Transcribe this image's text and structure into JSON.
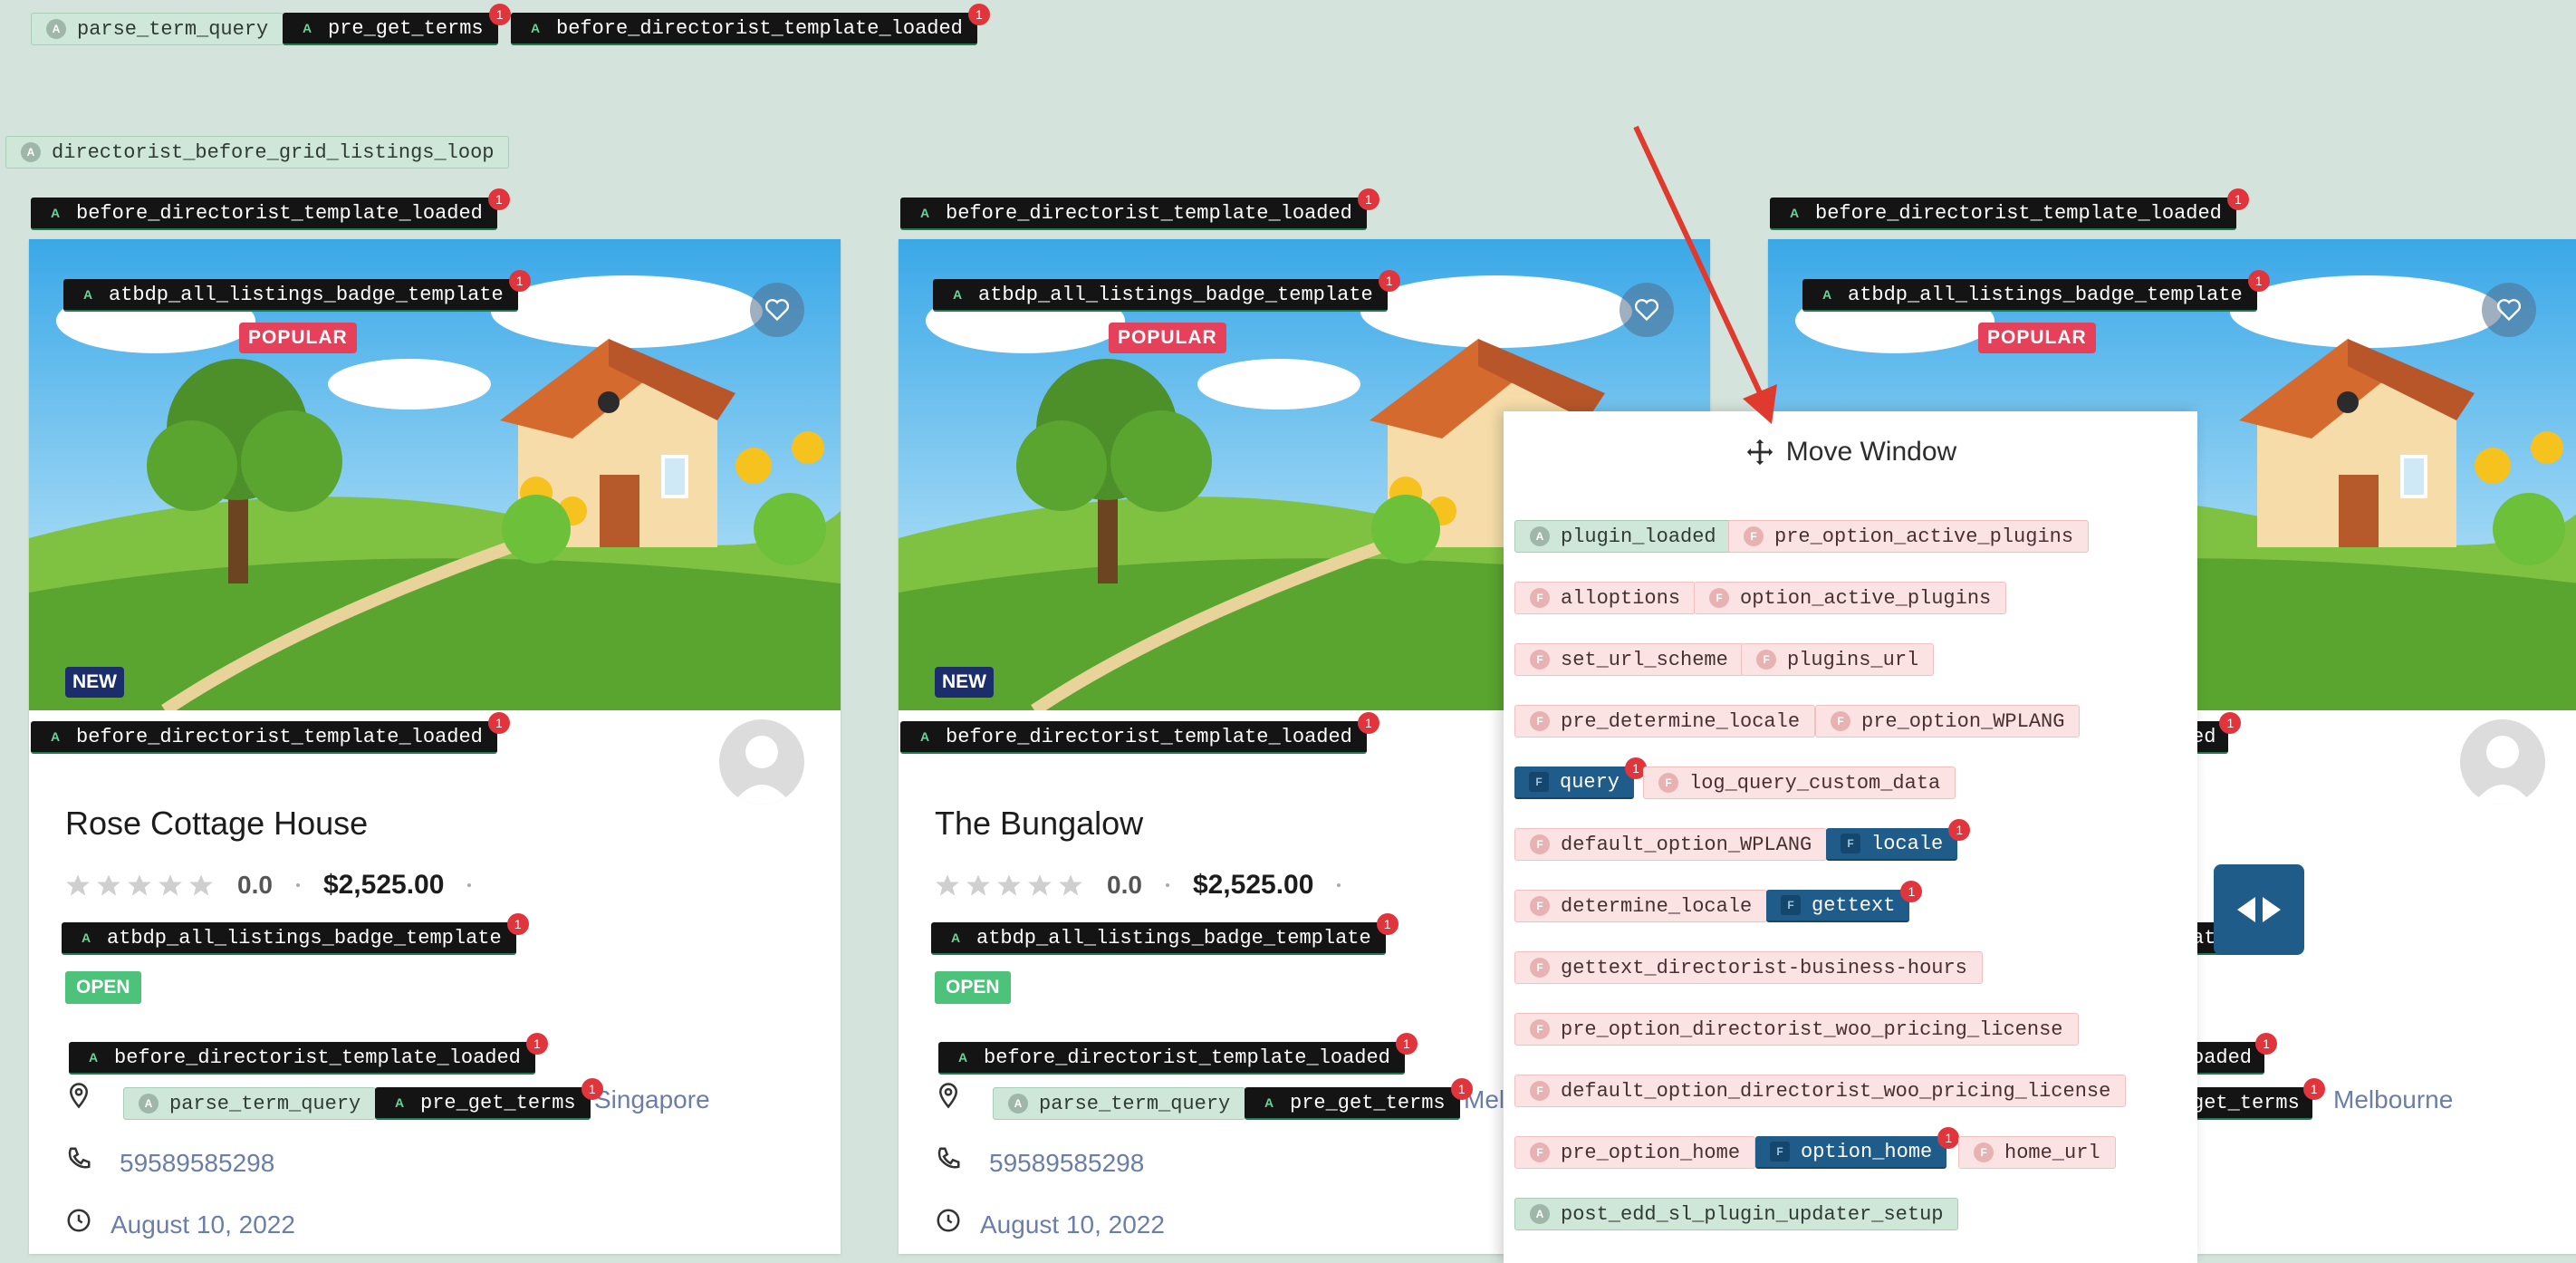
{
  "top_tags": [
    {
      "label": "parse_term_query",
      "style": "green",
      "icon": "A"
    },
    {
      "label": "pre_get_terms",
      "style": "dark",
      "icon": "A",
      "count": "1"
    },
    {
      "label": "before_directorist_template_loaded",
      "style": "dark",
      "icon": "A",
      "count": "1"
    },
    {
      "label": "directorist_before_grid_listings_loop",
      "style": "green",
      "icon": "A"
    }
  ],
  "card_hooks": {
    "before_template": "before_directorist_template_loaded",
    "badge_template": "atbdp_all_listings_badge_template",
    "parse_term_query": "parse_term_query",
    "pre_get_terms": "pre_get_terms",
    "hook_icon": "A",
    "count": "1"
  },
  "badges": {
    "popular": "POPULAR",
    "new": "NEW",
    "open": "OPEN"
  },
  "listings": [
    {
      "title": "Rose Cottage House",
      "rating": "0.0",
      "price": "$2,525.00",
      "location": "Singapore",
      "phone": "59589585298",
      "date": "August 10, 2022"
    },
    {
      "title": "The Bungalow",
      "rating": "0.0",
      "price": "$2,525.00",
      "location": "Mel",
      "phone": "59589585298",
      "date": "August 10, 2022"
    },
    {
      "title": "",
      "rating": "",
      "price": "",
      "location": "Melbourne",
      "phone": "",
      "date": ""
    }
  ],
  "partial_texts": {
    "card3_before_template": "ed",
    "card3_badge_template": "at",
    "card3_before_template_2": "oaded",
    "card3_pre_get_terms": "get_terms"
  },
  "move_window": {
    "title": "Move Window",
    "hooks": [
      {
        "label": "plugin_loaded",
        "style": "green",
        "icon": "A"
      },
      {
        "label": "pre_option_active_plugins",
        "style": "pink",
        "icon": "F"
      },
      {
        "label": "alloptions",
        "style": "pink",
        "icon": "F"
      },
      {
        "label": "option_active_plugins",
        "style": "pink",
        "icon": "F"
      },
      {
        "label": "set_url_scheme",
        "style": "pink",
        "icon": "F"
      },
      {
        "label": "plugins_url",
        "style": "pink",
        "icon": "F"
      },
      {
        "label": "pre_determine_locale",
        "style": "pink",
        "icon": "F"
      },
      {
        "label": "pre_option_WPLANG",
        "style": "pink",
        "icon": "F"
      },
      {
        "label": "query",
        "style": "blue",
        "icon": "F",
        "count": "1"
      },
      {
        "label": "log_query_custom_data",
        "style": "pink",
        "icon": "F"
      },
      {
        "label": "default_option_WPLANG",
        "style": "pink",
        "icon": "F"
      },
      {
        "label": "locale",
        "style": "blue",
        "icon": "F",
        "count": "1"
      },
      {
        "label": "determine_locale",
        "style": "pink",
        "icon": "F"
      },
      {
        "label": "gettext",
        "style": "blue",
        "icon": "F",
        "count": "1"
      },
      {
        "label": "gettext_directorist-business-hours",
        "style": "pink",
        "icon": "F"
      },
      {
        "label": "pre_option_directorist_woo_pricing_license",
        "style": "pink",
        "icon": "F"
      },
      {
        "label": "default_option_directorist_woo_pricing_license",
        "style": "pink",
        "icon": "F"
      },
      {
        "label": "pre_option_home",
        "style": "pink",
        "icon": "F"
      },
      {
        "label": "option_home",
        "style": "blue",
        "icon": "F",
        "count": "1"
      },
      {
        "label": "home_url",
        "style": "pink",
        "icon": "F"
      },
      {
        "label": "post_edd_sl_plugin_updater_setup",
        "style": "green",
        "icon": "A"
      }
    ]
  },
  "colors": {
    "background": "#d4e4dc",
    "accent_blue": "#1f5c8a",
    "popular_red": "#e5415a",
    "open_green": "#4cc27a",
    "new_navy": "#1b2e6b",
    "count_badge": "#e0353c",
    "annotation_arrow": "#e03a2f"
  },
  "icons": [
    "heart-icon",
    "location-pin-icon",
    "phone-icon",
    "clock-icon",
    "move-icon",
    "star-icon",
    "avatar-icon",
    "arrows-left-right-icon"
  ]
}
